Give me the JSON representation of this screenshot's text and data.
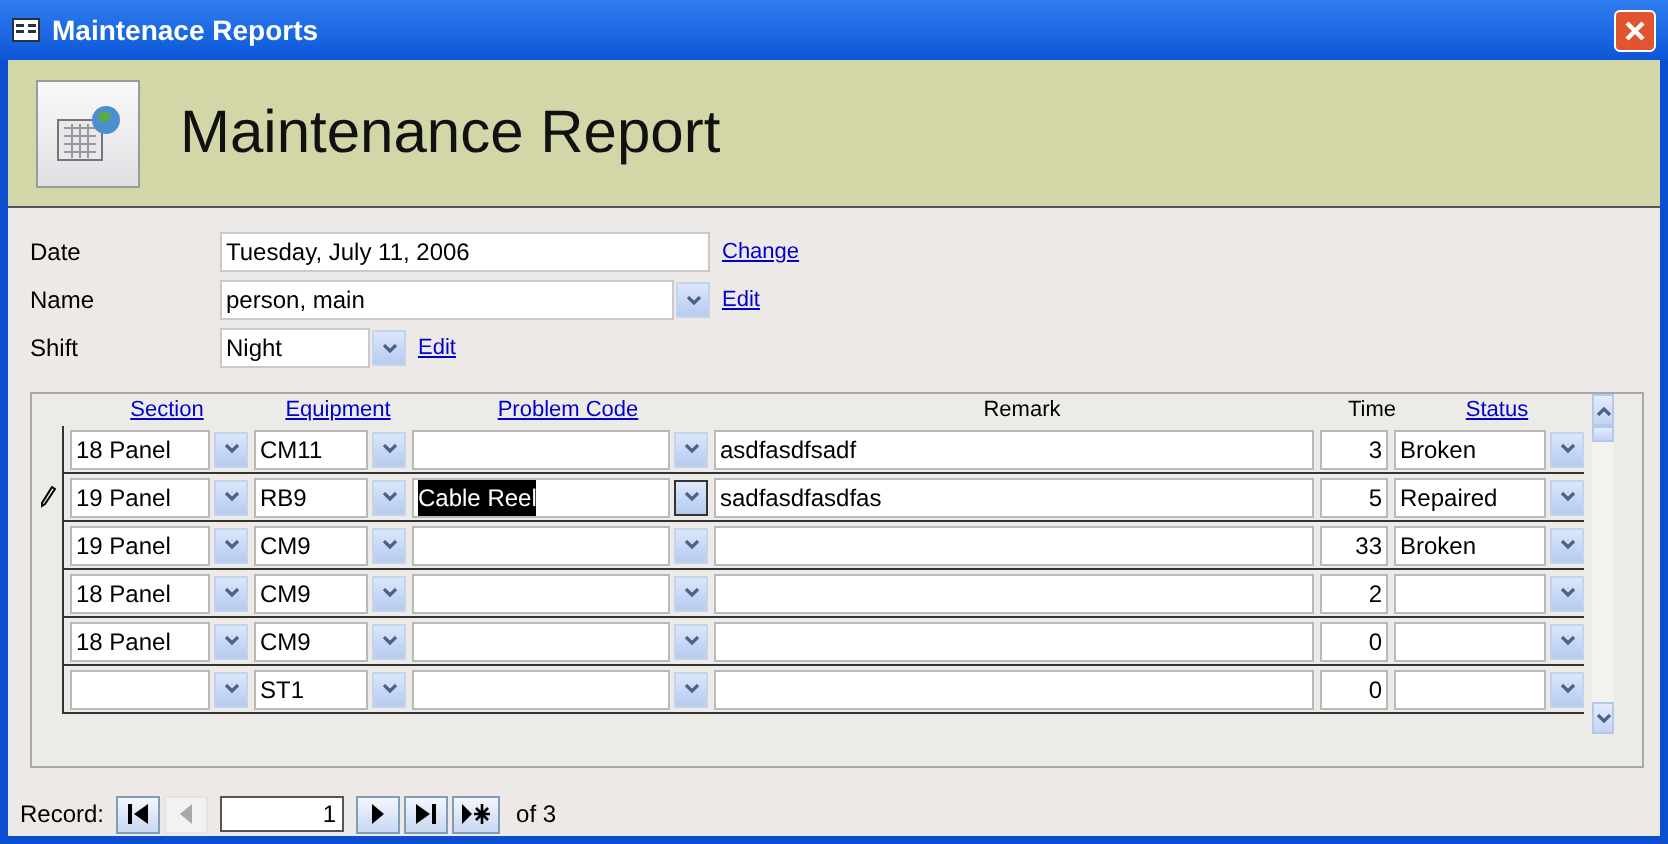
{
  "window": {
    "title": "Maintenace Reports"
  },
  "header": {
    "title": "Maintenance Report"
  },
  "fields": [
    {
      "kind": "text",
      "label": "Date",
      "value": "Tuesday, July 11, 2006",
      "link": "Change"
    },
    {
      "kind": "combo",
      "label": "Name",
      "value": "person, main",
      "link": "Edit"
    },
    {
      "kind": "combo_small",
      "label": "Shift",
      "value": "Night",
      "link": "Edit"
    }
  ],
  "table": {
    "columns": [
      {
        "label": "Section",
        "link": true
      },
      {
        "label": "Equipment",
        "link": true
      },
      {
        "label": "Problem Code",
        "link": true
      },
      {
        "label": "Remark",
        "link": false
      },
      {
        "label": "Time",
        "link": false
      },
      {
        "label": "Status",
        "link": true
      }
    ],
    "rows": [
      {
        "editing": false,
        "section": "18 Panel",
        "equipment": "CM11",
        "remark": "asdfasdfsadf",
        "time": "3",
        "status": "Broken"
      },
      {
        "editing": true,
        "section": "19 Panel",
        "equipment": "RB9",
        "problem_code": "Cable Reel",
        "remark": "sadfasdfasdfas",
        "time": "5",
        "status": "Repaired"
      },
      {
        "editing": false,
        "section": "19 Panel",
        "equipment": "CM9",
        "time": "33",
        "status": "Broken"
      },
      {
        "editing": false,
        "section": "18 Panel",
        "equipment": "CM9",
        "time": "2"
      },
      {
        "editing": false,
        "section": "18 Panel",
        "equipment": "CM9",
        "time": "0"
      },
      {
        "editing": false,
        "equipment": "ST1",
        "time": "0"
      }
    ]
  },
  "navigator": {
    "label": "Record:",
    "buttons": [
      {
        "kind": "first",
        "disabled": false
      },
      {
        "kind": "prev",
        "disabled": true
      },
      {
        "kind": "next",
        "disabled": false
      },
      {
        "kind": "last",
        "disabled": false
      },
      {
        "kind": "new",
        "disabled": false
      }
    ],
    "current": "1",
    "total": "of 3"
  }
}
